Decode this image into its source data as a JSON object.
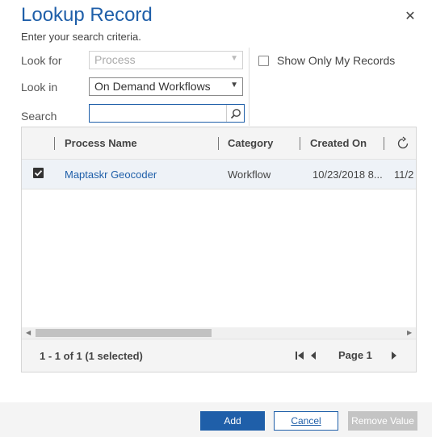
{
  "dialog": {
    "title": "Lookup Record",
    "subtitle": "Enter your search criteria.",
    "close_glyph": "✕"
  },
  "form": {
    "look_for_label": "Look for",
    "look_for_value": "Process",
    "look_in_label": "Look in",
    "look_in_value": "On Demand Workflows",
    "search_label": "Search",
    "search_value": "",
    "show_only_my_records": "Show Only My Records",
    "show_only_my_records_checked": false
  },
  "grid": {
    "columns": [
      "Process Name",
      "Category",
      "Created On"
    ],
    "rows": [
      {
        "selected": true,
        "process_name": "Maptaskr Geocoder",
        "category": "Workflow",
        "created_on": "10/23/2018 8...",
        "extra": "11/2"
      }
    ],
    "status": "1 - 1 of 1 (1 selected)",
    "page_label": "Page 1"
  },
  "buttons": {
    "add": "Add",
    "cancel": "Cancel",
    "remove_value": "Remove Value"
  },
  "colors": {
    "accent": "#1f5fa9",
    "panel": "#f4f4f4",
    "selected_row": "#eef2f7",
    "disabled_button": "#c4c4c4"
  },
  "icons": {
    "search": "magnifier-icon",
    "refresh": "refresh-icon",
    "first_page": "first-page-icon",
    "prev_page": "prev-page-icon",
    "next_page": "next-page-icon",
    "close": "close-icon"
  }
}
